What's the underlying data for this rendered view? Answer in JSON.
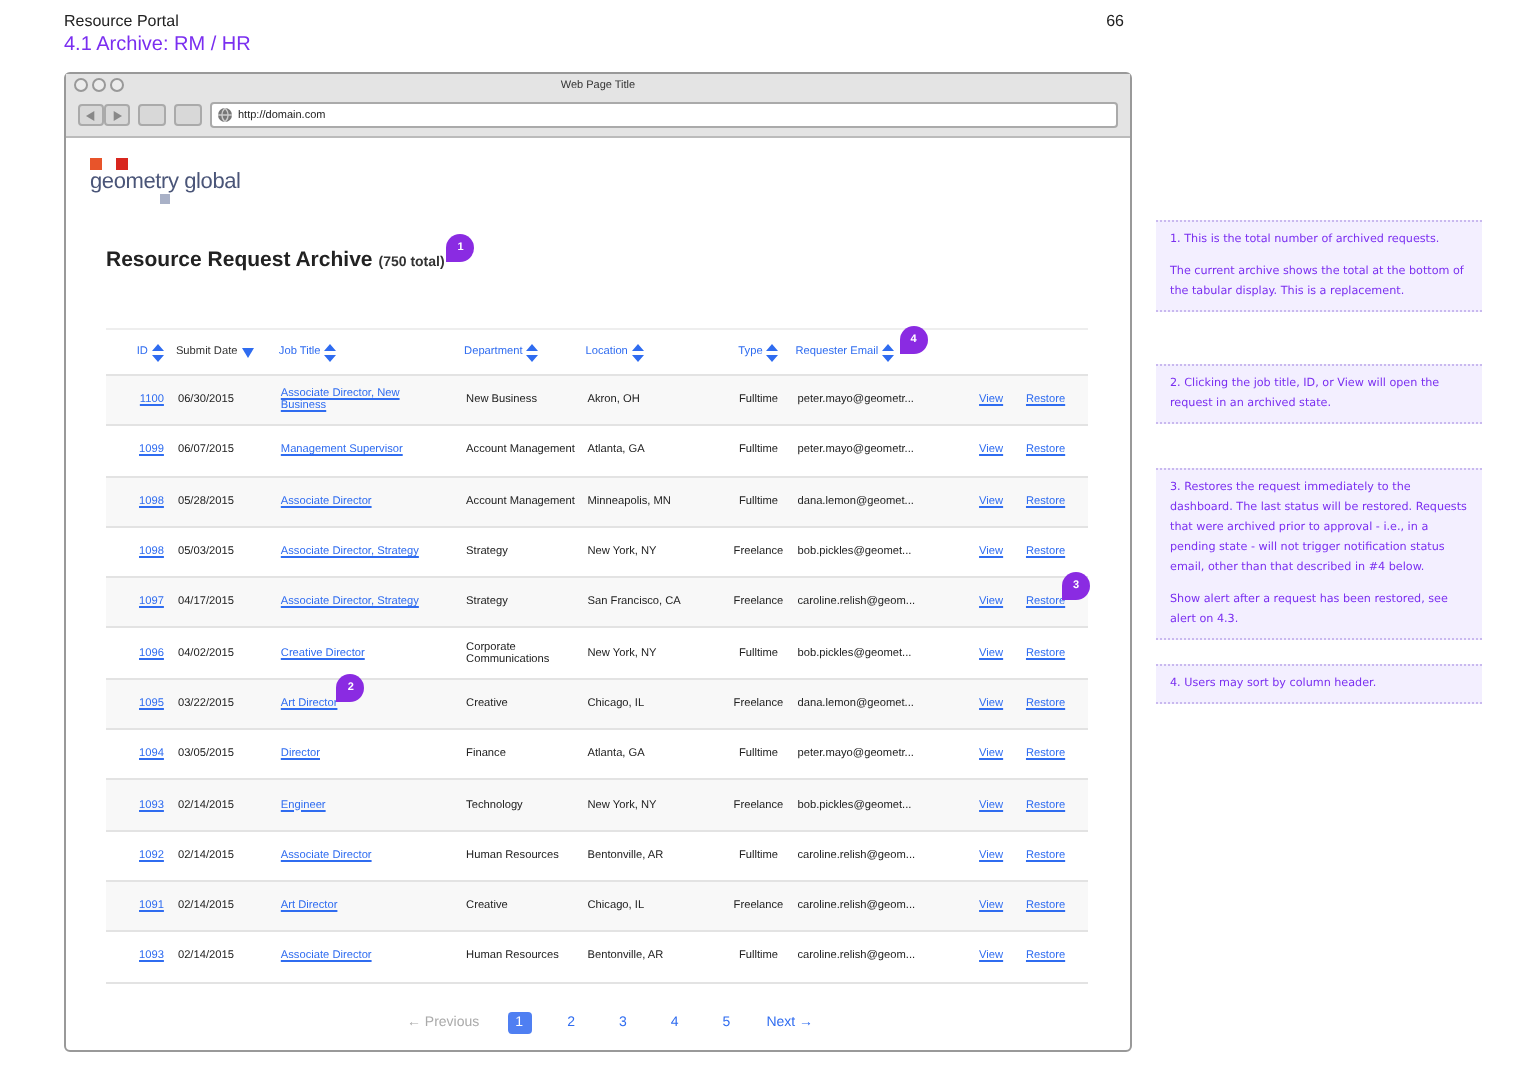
{
  "page": {
    "portal": "Resource Portal",
    "page_number": "66",
    "title": "4.1 Archive: RM / HR"
  },
  "browser": {
    "title": "Web Page Title",
    "url": "http://domain.com"
  },
  "logo": {
    "text": "geometry global"
  },
  "heading": {
    "title": "Resource Request Archive",
    "total": "(750 total)",
    "pin": "1"
  },
  "columns": [
    {
      "label": "ID",
      "sorted": false
    },
    {
      "label": "Submit Date",
      "sorted": true
    },
    {
      "label": "Job Title",
      "sorted": false
    },
    {
      "label": "Department",
      "sorted": false
    },
    {
      "label": "Location",
      "sorted": false
    },
    {
      "label": "Type",
      "sorted": false
    },
    {
      "label": "Requester Email",
      "sorted": false,
      "pin": "4"
    }
  ],
  "rows": [
    {
      "id": "1100",
      "date": "06/30/2015",
      "job": "Associate Director, New Business",
      "dept": "New Business",
      "location": "Akron, OH",
      "type": "Fulltime",
      "email": "peter.mayo@geometr...",
      "view": "View",
      "restore": "Restore"
    },
    {
      "id": "1099",
      "date": "06/07/2015",
      "job": "Management Supervisor",
      "dept": "Account Management",
      "location": "Atlanta, GA",
      "type": "Fulltime",
      "email": "peter.mayo@geometr...",
      "view": "View",
      "restore": "Restore"
    },
    {
      "id": "1098",
      "date": "05/28/2015",
      "job": "Associate Director",
      "dept": "Account Management",
      "location": "Minneapolis, MN",
      "type": "Fulltime",
      "email": "dana.lemon@geomet...",
      "view": "View",
      "restore": "Restore"
    },
    {
      "id": "1098",
      "date": "05/03/2015",
      "job": "Associate Director, Strategy",
      "dept": "Strategy",
      "location": "New York, NY",
      "type": "Freelance",
      "email": "bob.pickles@geomet...",
      "view": "View",
      "restore": "Restore"
    },
    {
      "id": "1097",
      "date": "04/17/2015",
      "job": "Associate Director, Strategy",
      "dept": "Strategy",
      "location": "San Francisco, CA",
      "type": "Freelance",
      "email": "caroline.relish@geom...",
      "view": "View",
      "restore": "Restore",
      "restore_pin": "3"
    },
    {
      "id": "1096",
      "date": "04/02/2015",
      "job": "Creative Director",
      "dept": "Corporate Communications",
      "location": "New York, NY",
      "type": "Fulltime",
      "email": "bob.pickles@geomet...",
      "view": "View",
      "restore": "Restore"
    },
    {
      "id": "1095",
      "date": "03/22/2015",
      "job": "Art Director",
      "dept": "Creative",
      "location": "Chicago, IL",
      "type": "Freelance",
      "email": "dana.lemon@geomet...",
      "view": "View",
      "restore": "Restore",
      "job_pin": "2"
    },
    {
      "id": "1094",
      "date": "03/05/2015",
      "job": "Director",
      "dept": "Finance",
      "location": "Atlanta, GA",
      "type": "Fulltime",
      "email": "peter.mayo@geometr...",
      "view": "View",
      "restore": "Restore"
    },
    {
      "id": "1093",
      "date": "02/14/2015",
      "job": "Engineer",
      "dept": "Technology",
      "location": "New York, NY",
      "type": "Freelance",
      "email": "bob.pickles@geomet...",
      "view": "View",
      "restore": "Restore"
    },
    {
      "id": "1092",
      "date": "02/14/2015",
      "job": "Associate Director",
      "dept": "Human Resources",
      "location": "Bentonville, AR",
      "type": "Fulltime",
      "email": "caroline.relish@geom...",
      "view": "View",
      "restore": "Restore"
    },
    {
      "id": "1091",
      "date": "02/14/2015",
      "job": "Art Director",
      "dept": "Creative",
      "location": "Chicago, IL",
      "type": "Freelance",
      "email": "caroline.relish@geom...",
      "view": "View",
      "restore": "Restore"
    },
    {
      "id": "1093",
      "date": "02/14/2015",
      "job": "Associate Director",
      "dept": "Human Resources",
      "location": "Bentonville, AR",
      "type": "Fulltime",
      "email": "caroline.relish@geom...",
      "view": "View",
      "restore": "Restore"
    }
  ],
  "pagination": {
    "previous": {
      "label": "← Previous",
      "disabled": true
    },
    "pages": [
      {
        "label": "1",
        "selected": true
      },
      {
        "label": "2",
        "selected": false
      },
      {
        "label": "3",
        "selected": false
      },
      {
        "label": "4",
        "selected": false
      },
      {
        "label": "5",
        "selected": false
      }
    ],
    "next": {
      "label": "Next →",
      "disabled": false
    }
  },
  "notes": [
    {
      "paragraphs": [
        "1. This is the total number of archived requests.",
        "The current archive shows the total at the bottom of the tabular display. This is a replacement."
      ]
    },
    {
      "paragraphs": [
        "2. Clicking the job title, ID, or View will open the request in an archived state."
      ]
    },
    {
      "paragraphs": [
        "3. Restores the request immediately to the dashboard. The last status will be restored. Requests that were archived prior to approval - i.e., in a pending state - will not trigger notification status email, other than that described in #4 below.",
        "Show alert after a request has been restored, see alert on 4.3."
      ]
    },
    {
      "paragraphs": [
        "4. Users may sort by column header."
      ]
    }
  ]
}
